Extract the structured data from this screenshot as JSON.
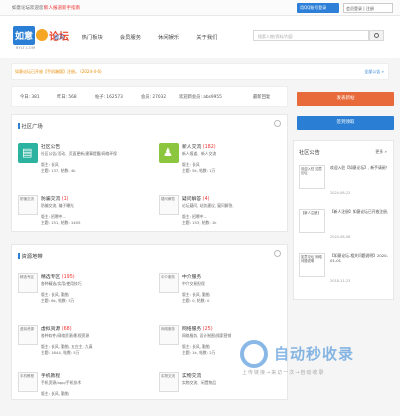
{
  "topbar": {
    "welcome": "如意论坛欢迎您!",
    "register": "新人报道",
    "guide": "新手指南",
    "qq_login": "用QQ账号登录",
    "member_login": "会员登录 | 注册"
  },
  "header": {
    "logo_left": "如意",
    "logo_right": "论坛",
    "logo_sub": "RYLT.COM",
    "nav": [
      "首页",
      "热门板块",
      "会员服务",
      "休闲娱乐",
      "关于我们"
    ],
    "search_placeholder": "搜索人物/资料/内容"
  },
  "notice": {
    "text": "如意论坛已开放【手机端版】注册。 (2024-4-6)",
    "more": "全部公告 »"
  },
  "stats": {
    "today": "今日: 381",
    "yesterday": "昨日: 568",
    "posts": "帖子: 162573",
    "members": "会员: 27032",
    "newest": "欢迎新会员: abs9955",
    "latest_reply": "最新回复"
  },
  "buttons": {
    "post": "发表新帖",
    "checkin": "签到领取"
  },
  "community": {
    "title": "社区广场",
    "forums": [
      {
        "name": "社区公告",
        "count": "",
        "desc1": "社区公告/活动、页面更新/建事提醒/网络环保",
        "desc2": "",
        "mod": "版主: 长风",
        "stat": "主题: 137, 帖数: 4k",
        "color": "#2bb3a0",
        "glyph": "▤"
      },
      {
        "name": "新人交流",
        "count": "(182)",
        "desc1": "新人报道、新人交流",
        "desc2": "",
        "mod": "版主: 长风",
        "stat": "主题: 5k, 帖数: 1万",
        "color": "#8cc63f",
        "glyph": "♟"
      },
      {
        "name": "防骗交流",
        "count": "(1)",
        "desc1": "防骗交流, 骗子曝光",
        "desc2": "",
        "mod": "版主: 招聘中...",
        "stat": "主题: 151, 帖数: 1405",
        "thumb": "防骗交流"
      },
      {
        "name": "疑问解答",
        "count": "(4)",
        "desc1": "论坛疑问, 站务建议, 疑问解答,",
        "desc2": "",
        "mod": "版主: 招聘中...",
        "stat": "主题: 153, 帖数: 1k",
        "thumb": "疑问解答"
      }
    ]
  },
  "resources": {
    "title": "资源地带",
    "forums": [
      {
        "name": "精选专区",
        "count": "(195)",
        "desc1": "各种精选/实用/使用技巧",
        "desc2": "",
        "mod": "版主: 长风, 勤勉",
        "stat": "主题: 6k, 帖数: 3万",
        "thumb": "精选专区"
      },
      {
        "name": "中介服务",
        "count": "",
        "desc1": "中介交易担保",
        "desc2": "",
        "mod": "版主: 长风, 勤勉",
        "stat": "主题: 0, 帖数: 0",
        "thumb": "中介服务"
      },
      {
        "name": "虚拟资源",
        "count": "(68)",
        "desc1": "各种软件/网络资源/影视资源",
        "desc2": "",
        "mod": "版主: 长风, 勤勉, 五庄主, 九真",
        "stat": "主题: 1644, 帖数: 5万",
        "thumb": "虚拟资源"
      },
      {
        "name": "网络服务",
        "count": "(25)",
        "desc1": "网络服务, 设计制图/搜索营销",
        "desc2": "",
        "mod": "版主: 长风, 勤勉",
        "stat": "主题: 1k, 帖数: 2万",
        "thumb": "网络服务"
      },
      {
        "name": "手机教程",
        "count": "",
        "desc1": "手机资源/app/手机技术",
        "desc2": "",
        "mod": "版主: 长风, 勤勉",
        "stat": "",
        "thumb": "手机教程"
      },
      {
        "name": "实物交流",
        "count": "",
        "desc1": "实物交流、闲置物品",
        "desc2": "",
        "mod": "",
        "stat": "",
        "thumb": "实物交流"
      }
    ]
  },
  "sidebar": {
    "title": "社区公告",
    "more": "更多 »",
    "items": [
      {
        "thumb": "欢迎入驻 如意论坛",
        "text": "欢迎入驻【如意论坛】, 新手请阅！",
        "date": "2024-06-22"
      },
      {
        "thumb": "【新人注册】",
        "text": "【新人注册】如意论坛已开放注册,",
        "date": "2024-06-06"
      },
      {
        "thumb": "如意论坛 网络问题说明",
        "text": "【如意论坛-相关问题说明】2020-01-01",
        "date": "2018-11-23"
      }
    ]
  },
  "watermark": {
    "text": "自动秒收录",
    "sub": "上传链接→来访一次→自动收录"
  }
}
